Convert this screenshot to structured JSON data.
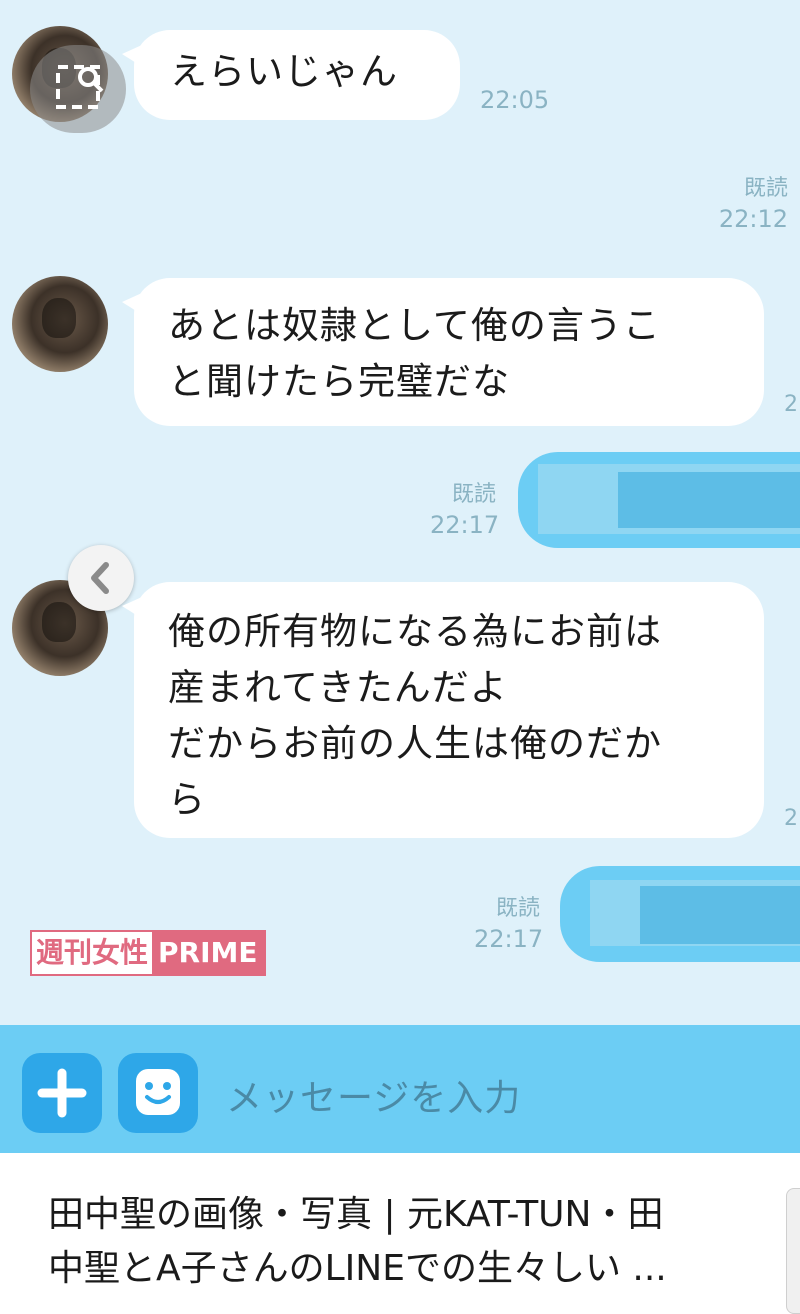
{
  "messages": [
    {
      "side": "in",
      "text": "えらいじゃん",
      "time": "22:05"
    },
    {
      "side": "out",
      "read": "既読",
      "time": "22:12"
    },
    {
      "side": "in",
      "text": "あとは奴隷として俺の言うこと聞けたら完璧だな",
      "time_clipped": "2"
    },
    {
      "side": "out",
      "read": "既読",
      "time": "22:17"
    },
    {
      "side": "in",
      "text": "俺の所有物になる為にお前は産まれてきたんだよ\nだからお前の人生は俺のだから",
      "time_clipped": "2"
    },
    {
      "side": "out",
      "read": "既読",
      "time": "22:17"
    }
  ],
  "lines": {
    "m3": [
      "あとは奴隷として俺の言うこ",
      "と聞けたら完璧だな"
    ],
    "m5": [
      "俺の所有物になる為にお前は",
      "産まれてきたんだよ",
      "だからお前の人生は俺のだか",
      "ら"
    ]
  },
  "watermark": {
    "text": "週刊女性",
    "brand": "PRIME"
  },
  "input": {
    "placeholder": "メッセージを入力"
  },
  "caption": [
    "田中聖の画像・写真 | 元KAT-TUN・田",
    "中聖とA子さんのLINEでの生々しい ..."
  ],
  "icons": {
    "add": "plus-icon",
    "sticker": "smile-icon",
    "image": "image-search-icon",
    "back": "chevron-left-icon"
  },
  "colors": {
    "chat_bg": "#dff1fa",
    "outgoing_bubble": "#6ccdf4",
    "input_bar": "#6ccdf4",
    "button": "#2ea7e8",
    "watermark": "#e06a80"
  }
}
